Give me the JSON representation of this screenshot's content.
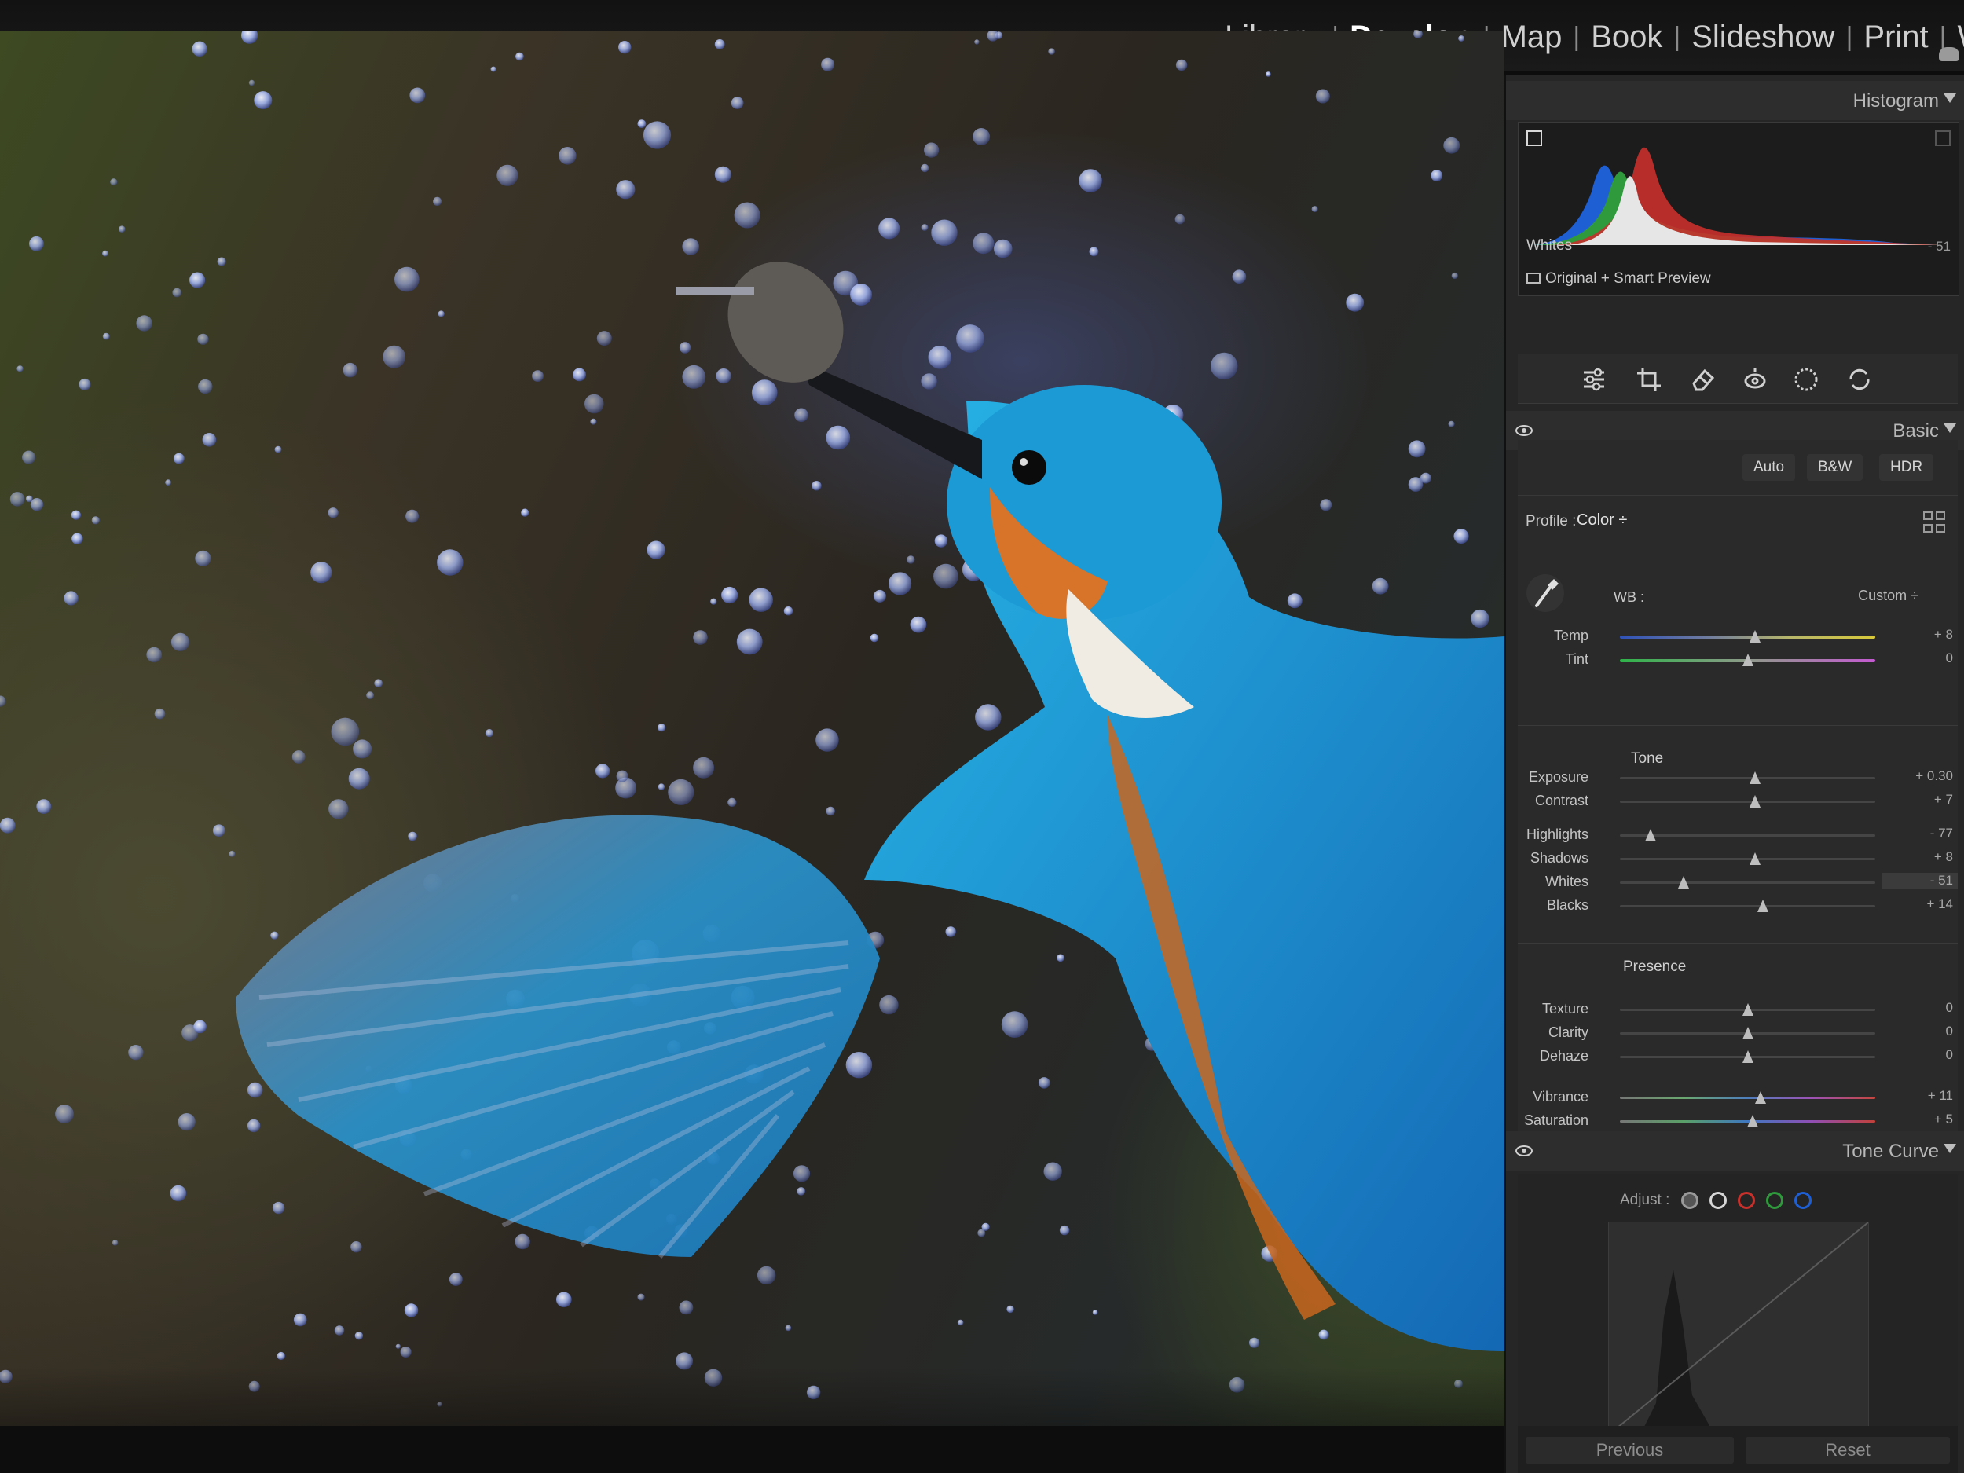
{
  "modules": [
    "Library",
    "Develop",
    "Map",
    "Book",
    "Slideshow",
    "Print",
    "Web"
  ],
  "active_module": "Develop",
  "histogram": {
    "title": "Histogram",
    "readout_label": "Whites",
    "readout_value": "- 51",
    "preview_label": "Original + Smart Preview"
  },
  "tools": [
    "sliders-icon",
    "crop-icon",
    "eraser-icon",
    "redeye-icon",
    "mask-icon",
    "reset-icon"
  ],
  "basic": {
    "title": "Basic",
    "buttons": {
      "auto": "Auto",
      "bw": "B&W",
      "hdr": "HDR"
    },
    "profile_label": "Profile :",
    "profile_value": "Color ÷",
    "wb_label": "WB :",
    "wb_value": "Custom ÷",
    "tone_label": "Tone",
    "presence_label": "Presence",
    "sliders": [
      {
        "key": "temp",
        "label": "Temp",
        "value": "+ 8",
        "pos": 0.53
      },
      {
        "key": "tint",
        "label": "Tint",
        "value": "0",
        "pos": 0.5
      },
      {
        "key": "exposure",
        "label": "Exposure",
        "value": "+ 0.30",
        "pos": 0.53
      },
      {
        "key": "contrast",
        "label": "Contrast",
        "value": "+ 7",
        "pos": 0.53
      },
      {
        "key": "highlights",
        "label": "Highlights",
        "value": "- 77",
        "pos": 0.12
      },
      {
        "key": "shadows",
        "label": "Shadows",
        "value": "+ 8",
        "pos": 0.53
      },
      {
        "key": "whites",
        "label": "Whites",
        "value": "- 51",
        "pos": 0.25
      },
      {
        "key": "blacks",
        "label": "Blacks",
        "value": "+ 14",
        "pos": 0.56
      },
      {
        "key": "texture",
        "label": "Texture",
        "value": "0",
        "pos": 0.5
      },
      {
        "key": "clarity",
        "label": "Clarity",
        "value": "0",
        "pos": 0.5
      },
      {
        "key": "dehaze",
        "label": "Dehaze",
        "value": "0",
        "pos": 0.5
      },
      {
        "key": "vibrance",
        "label": "Vibrance",
        "value": "+ 11",
        "pos": 0.55
      },
      {
        "key": "saturation",
        "label": "Saturation",
        "value": "+ 5",
        "pos": 0.52
      }
    ]
  },
  "tone_curve": {
    "title": "Tone Curve",
    "adjust_label": "Adjust :"
  },
  "footer": {
    "previous": "Previous",
    "reset": "Reset"
  },
  "colors": {
    "panel_bg": "#262626",
    "bird_blue": "#1ea0d8",
    "bird_orange": "#d8742a",
    "hist_blue": "#1f5fd4",
    "hist_green": "#2f9a3c",
    "hist_red": "#c8302c"
  }
}
